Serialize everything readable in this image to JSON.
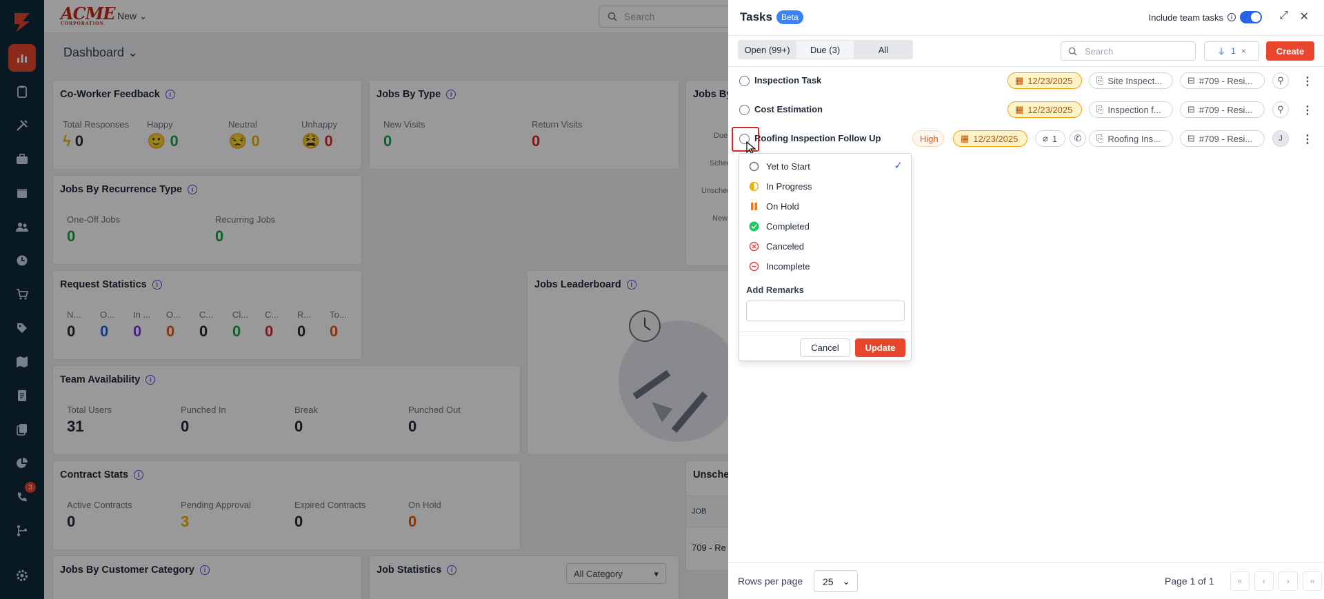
{
  "app": {
    "logo_text": "ACME",
    "logo_sub": "CORPORATION",
    "new_label": "New",
    "search_placeholder": "Search",
    "dashboard_label": "Dashboard",
    "brand_color": "#e8452c"
  },
  "sidebar": {
    "items": [
      {
        "icon": "logo-bolt-icon"
      },
      {
        "icon": "chart-bar-icon",
        "active": true
      },
      {
        "icon": "clipboard-icon"
      },
      {
        "icon": "tools-icon"
      },
      {
        "icon": "briefcase-icon"
      },
      {
        "icon": "calendar-icon"
      },
      {
        "icon": "users-icon"
      },
      {
        "icon": "clock-icon"
      },
      {
        "icon": "cart-icon"
      },
      {
        "icon": "tag-icon"
      },
      {
        "icon": "map-icon"
      },
      {
        "icon": "document-icon"
      },
      {
        "icon": "copy-icon"
      },
      {
        "icon": "pie-chart-icon"
      },
      {
        "icon": "phone-icon"
      },
      {
        "icon": "flow-icon"
      },
      {
        "icon": "settings-icon"
      }
    ],
    "phone_badge": "3"
  },
  "cards": {
    "coworker": {
      "title": "Co-Worker Feedback",
      "stats": [
        {
          "label": "Total Responses",
          "value": "0"
        },
        {
          "label": "Happy",
          "value": "0"
        },
        {
          "label": "Neutral",
          "value": "0"
        },
        {
          "label": "Unhappy",
          "value": "0"
        }
      ]
    },
    "jobs_by_type": {
      "title": "Jobs By Type",
      "stats": [
        {
          "label": "New Visits",
          "value": "0"
        },
        {
          "label": "Return Visits",
          "value": "0"
        }
      ]
    },
    "jobs_by_peek": {
      "title": "Jobs By",
      "labels": [
        "Due",
        "Sched",
        "Unsched",
        "New"
      ]
    },
    "recurrence": {
      "title": "Jobs By Recurrence Type",
      "stats": [
        {
          "label": "One-Off Jobs",
          "value": "0"
        },
        {
          "label": "Recurring Jobs",
          "value": "0"
        }
      ]
    },
    "request": {
      "title": "Request Statistics",
      "stats": [
        {
          "label": "N...",
          "value": "0"
        },
        {
          "label": "O...",
          "value": "0"
        },
        {
          "label": "In ...",
          "value": "0"
        },
        {
          "label": "O...",
          "value": "0"
        },
        {
          "label": "C...",
          "value": "0"
        },
        {
          "label": "Cl...",
          "value": "0"
        },
        {
          "label": "C...",
          "value": "0"
        },
        {
          "label": "R...",
          "value": "0"
        },
        {
          "label": "To...",
          "value": "0"
        }
      ]
    },
    "leaderboard": {
      "title": "Jobs Leaderboard"
    },
    "team": {
      "title": "Team Availability",
      "stats": [
        {
          "label": "Total Users",
          "value": "31"
        },
        {
          "label": "Punched In",
          "value": "0"
        },
        {
          "label": "Break",
          "value": "0"
        },
        {
          "label": "Punched Out",
          "value": "0"
        }
      ]
    },
    "contract": {
      "title": "Contract Stats",
      "stats": [
        {
          "label": "Active Contracts",
          "value": "0"
        },
        {
          "label": "Pending Approval",
          "value": "3"
        },
        {
          "label": "Expired Contracts",
          "value": "0"
        },
        {
          "label": "On Hold",
          "value": "0"
        }
      ]
    },
    "unsched": {
      "title": "Unsche",
      "col": "JOB",
      "row": "709 - Re"
    },
    "customer_cat": {
      "title": "Jobs By Customer Category"
    },
    "job_stats": {
      "title": "Job Statistics",
      "select": "All Category"
    }
  },
  "panel": {
    "title": "Tasks",
    "beta": "Beta",
    "include_label": "Include team tasks",
    "tabs": [
      {
        "label": "Open (99+)"
      },
      {
        "label": "Due (3)"
      },
      {
        "label": "All"
      }
    ],
    "search_placeholder": "Search",
    "filter_count": "1",
    "create_label": "Create",
    "tasks": [
      {
        "name": "Inspection Task",
        "date": "12/23/2025",
        "ref": "Site Inspect...",
        "job": "#709 - Resi..."
      },
      {
        "name": "Cost Estimation",
        "date": "12/23/2025",
        "ref": "Inspection f...",
        "job": "#709 - Resi..."
      },
      {
        "name": "Roofing Inspection Follow Up",
        "priority": "High",
        "date": "12/23/2025",
        "attach": "1",
        "ref": "Roofing Ins...",
        "job": "#709 - Resi...",
        "assignee": "J"
      }
    ],
    "status_menu": {
      "options": [
        {
          "label": "Yet to Start",
          "icon": "empty-circle-icon",
          "selected": true
        },
        {
          "label": "In Progress",
          "icon": "half-circle-icon"
        },
        {
          "label": "On Hold",
          "icon": "pause-icon"
        },
        {
          "label": "Completed",
          "icon": "check-circle-icon"
        },
        {
          "label": "Canceled",
          "icon": "x-circle-icon"
        },
        {
          "label": "Incomplete",
          "icon": "minus-circle-icon"
        }
      ],
      "remarks_label": "Add Remarks",
      "cancel_label": "Cancel",
      "update_label": "Update"
    },
    "footer": {
      "rows_label": "Rows per page",
      "rows_value": "25",
      "page_text": "Page 1 of 1"
    }
  }
}
